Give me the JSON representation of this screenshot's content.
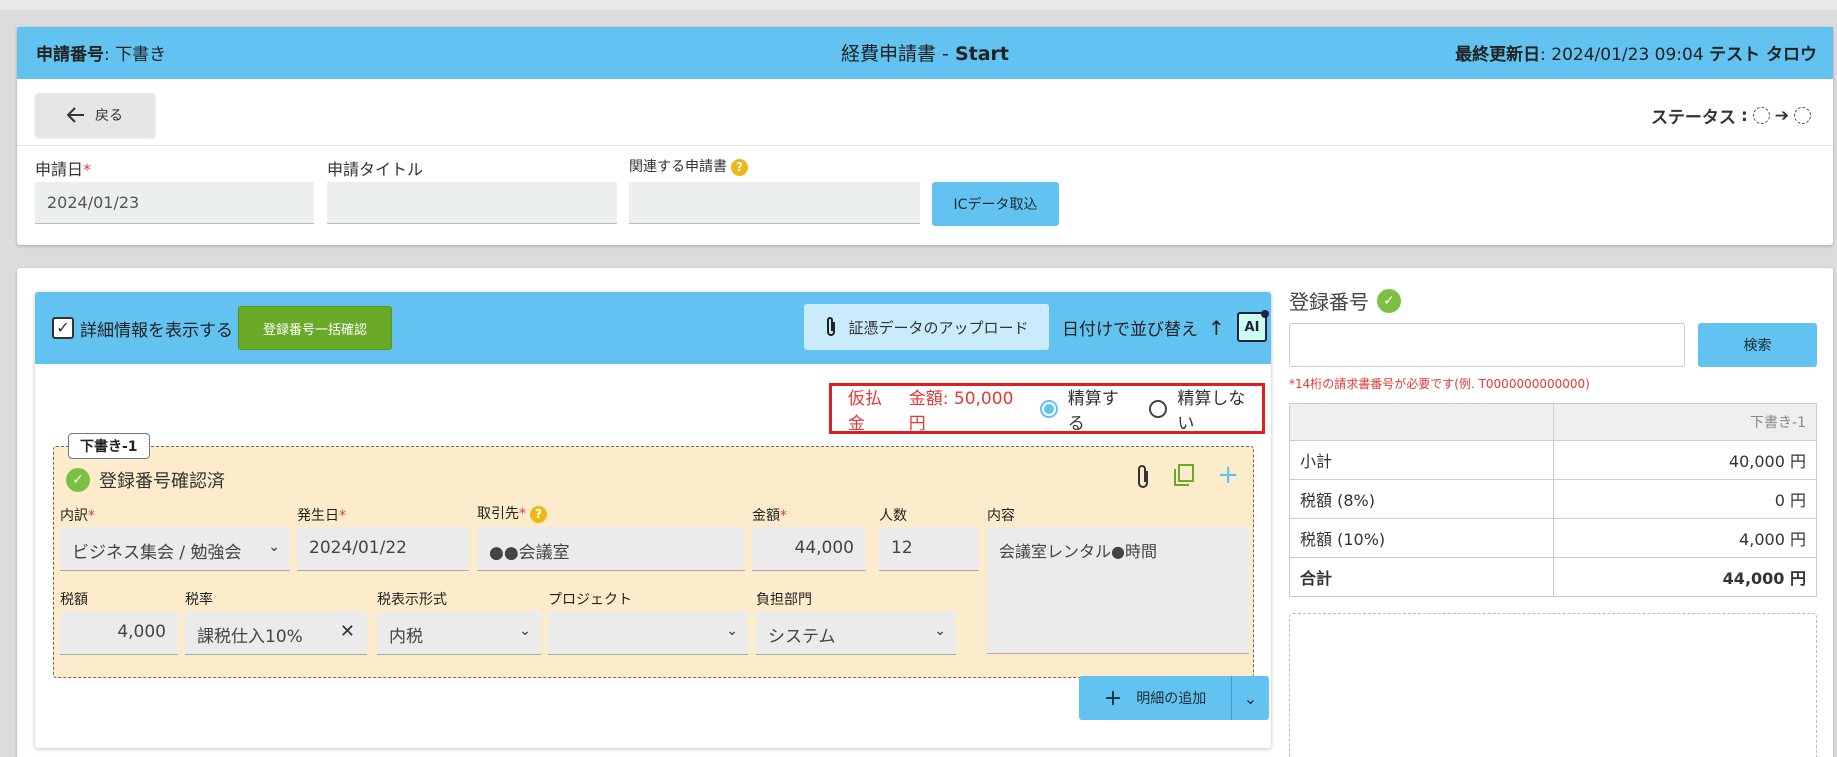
{
  "header": {
    "app_no_label": "申請番号",
    "app_no_value": "下書き",
    "title_main": "経費申請書 - ",
    "title_bold": "Start",
    "updated_label": "最終更新日",
    "updated_value": "2024/01/23 09:04",
    "user": "テスト タロウ"
  },
  "back_label": "戻る",
  "status_label": "ステータス",
  "form": {
    "date_label": "申請日",
    "date_value": "2024/01/23",
    "title_label": "申請タイトル",
    "title_value": "",
    "related_label": "関連する申請書",
    "related_value": "",
    "ic_button": "ICデータ取込"
  },
  "toolbar": {
    "show_details": "詳細情報を表示する",
    "batch_confirm": "登録番号一括確認",
    "upload": "証憑データのアップロード",
    "sort": "日付けで並び替え"
  },
  "advance": {
    "label": "仮払金",
    "amount": "金額: 50,000円",
    "settle": "精算する",
    "no_settle": "精算しない",
    "selected": "settle"
  },
  "entry": {
    "tag": "下書き-1",
    "confirmed": "登録番号確認済",
    "fields": {
      "category_label": "内訳",
      "category_value": "ビジネス集会 / 勉強会",
      "date_label": "発生日",
      "date_value": "2024/01/22",
      "vendor_label": "取引先",
      "vendor_value": "●●会議室",
      "amount_label": "金額",
      "amount_value": "44,000",
      "people_label": "人数",
      "people_value": "12",
      "content_label": "内容",
      "content_value": "会議室レンタル●時間",
      "tax_label": "税額",
      "tax_value": "4,000",
      "rate_label": "税率",
      "rate_value": "課税仕入10%",
      "display_label": "税表示形式",
      "display_value": "内税",
      "project_label": "プロジェクト",
      "project_value": "",
      "dept_label": "負担部門",
      "dept_value": "システム"
    }
  },
  "add_detail": "明細の追加",
  "right": {
    "reg_title": "登録番号",
    "search": "検索",
    "hint": "*14桁の請求書番号が必要です(例. T0000000000000)",
    "table_head": "下書き-1",
    "rows": [
      {
        "label": "小計",
        "value": "40,000 円"
      },
      {
        "label": "税額 (8%)",
        "value": "0 円"
      },
      {
        "label": "税額 (10%)",
        "value": "4,000 円"
      },
      {
        "label": "合計",
        "value": "44,000 円"
      }
    ]
  },
  "colors": {
    "header_blue": "#62c3f0",
    "accent_green": "#6aaa28",
    "alert_red": "#e53935"
  }
}
